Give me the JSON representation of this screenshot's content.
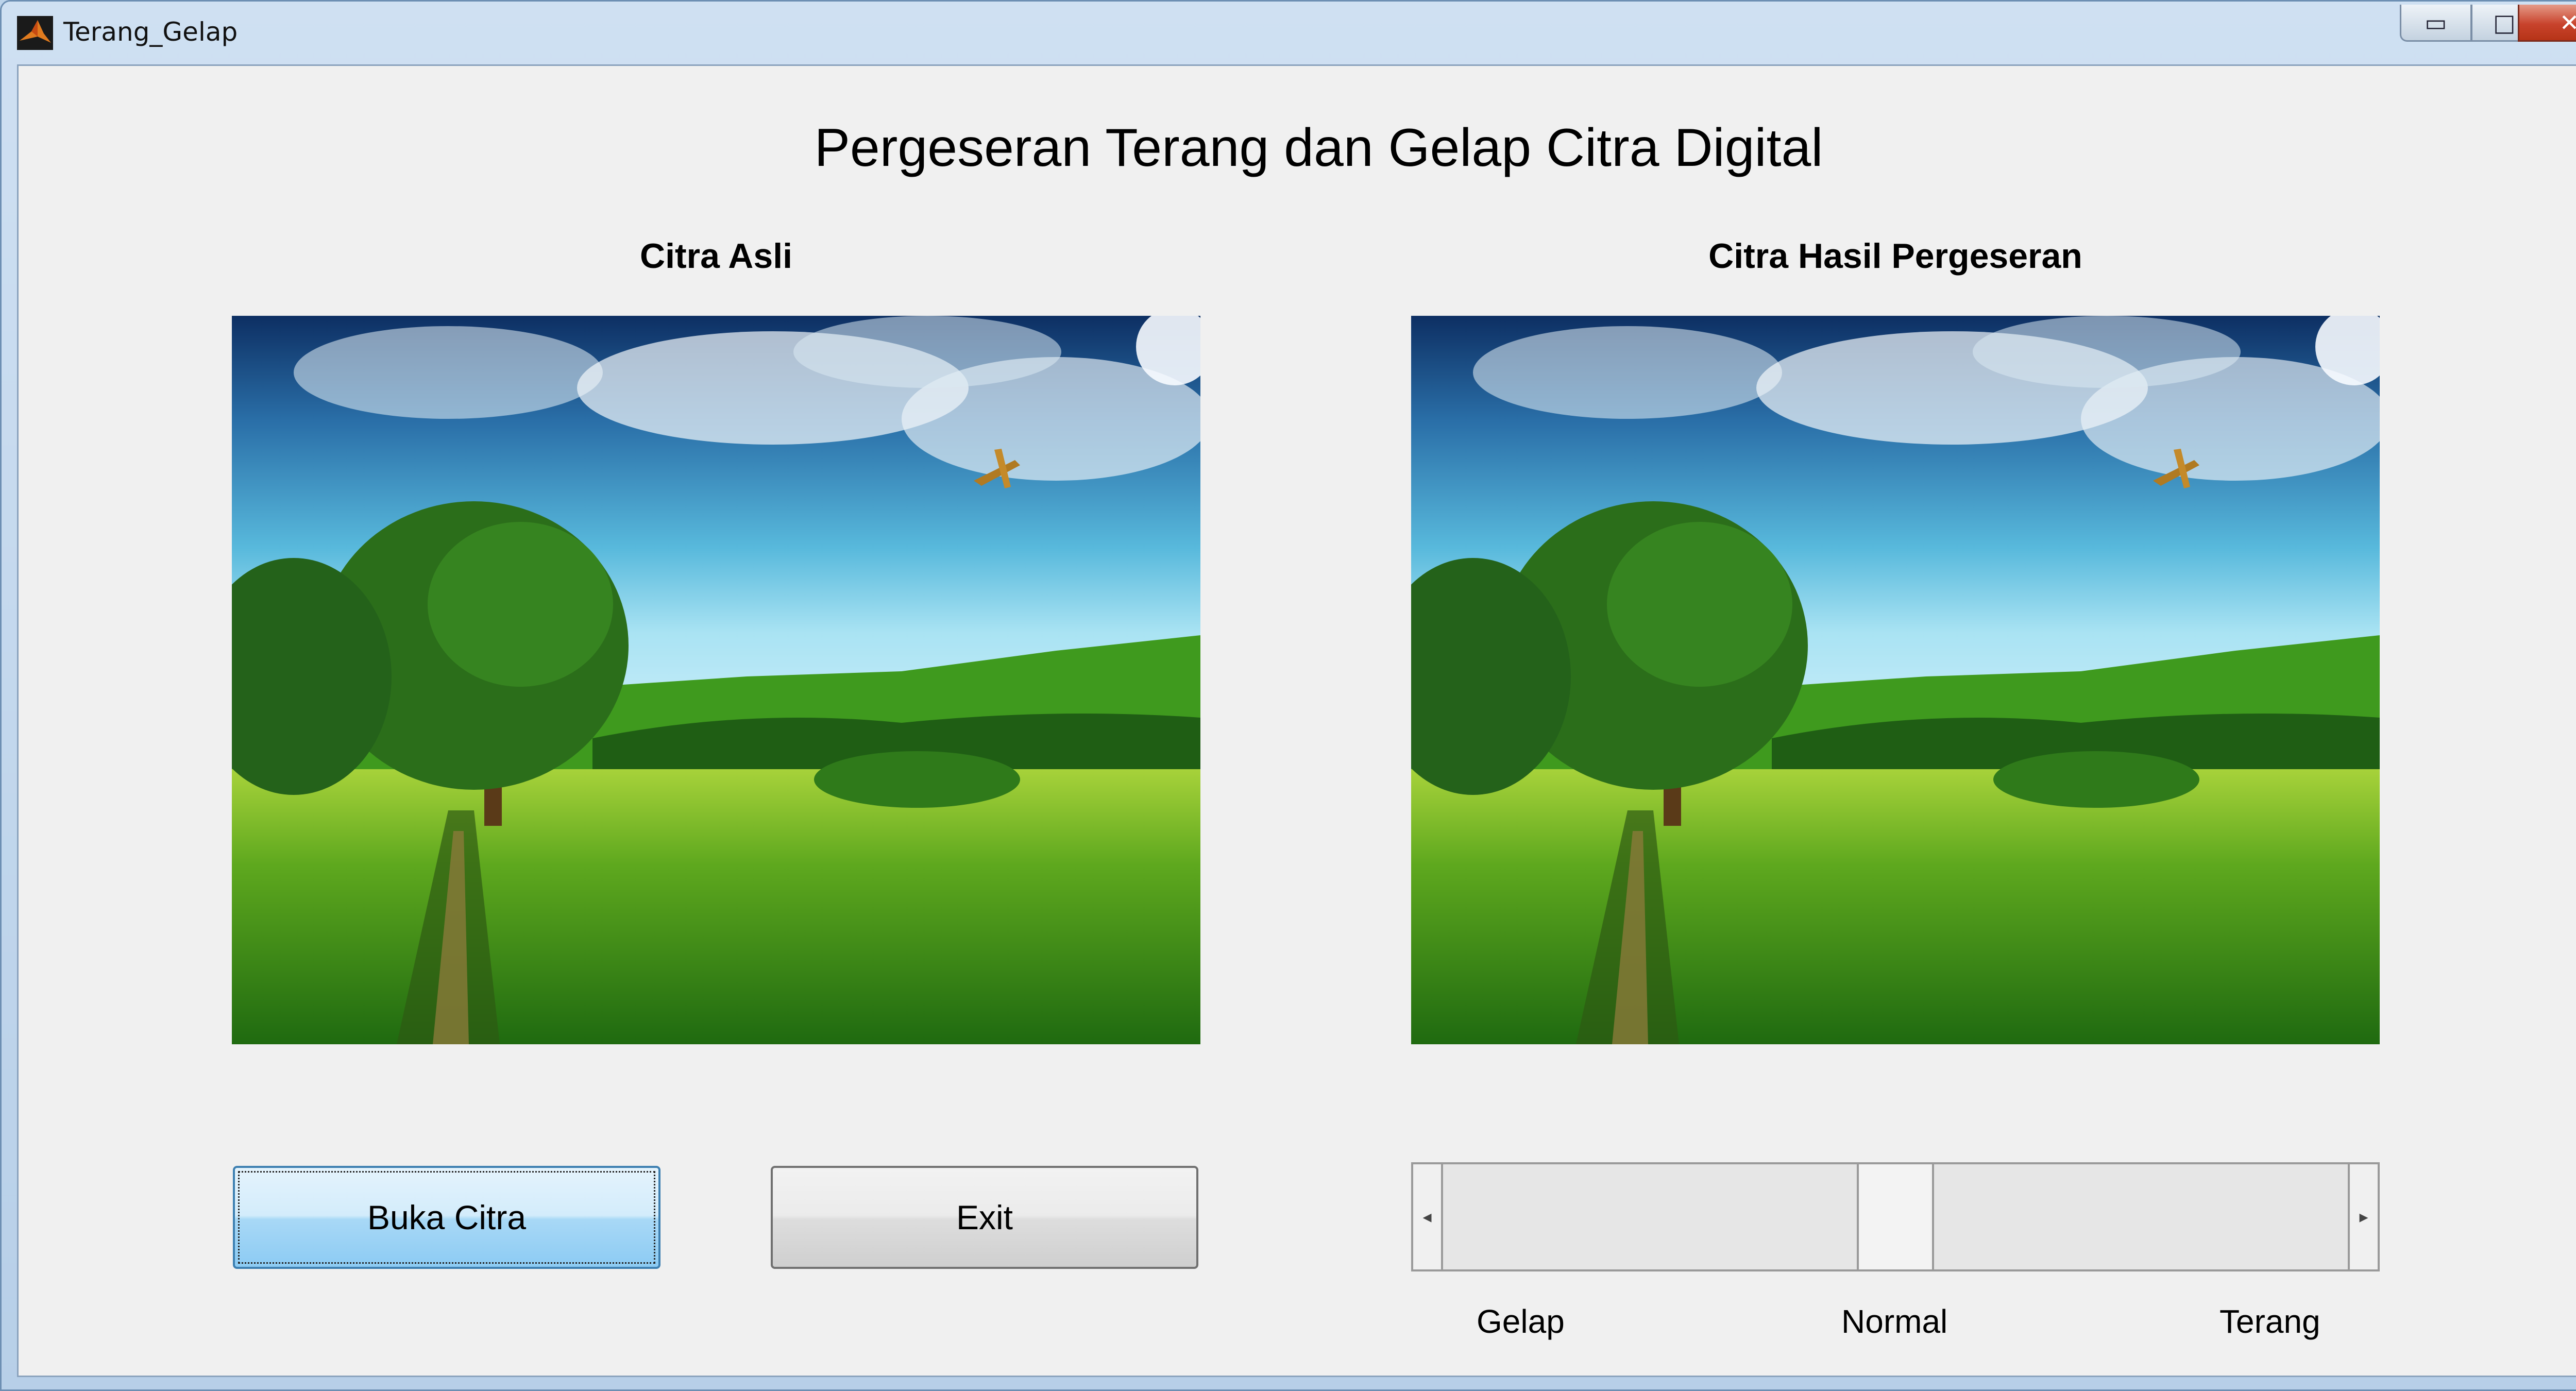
{
  "window": {
    "title": "Terang_Gelap",
    "controls": {
      "minimize": "▭",
      "maximize": "□",
      "close": "✕"
    }
  },
  "heading": "Pergeseran Terang dan Gelap Citra Digital",
  "panels": {
    "original_label": "Citra Asli",
    "result_label": "Citra Hasil Pergeseran"
  },
  "buttons": {
    "open": "Buka Citra",
    "exit": "Exit"
  },
  "slider": {
    "labels": {
      "left": "Gelap",
      "middle": "Normal",
      "right": "Terang"
    },
    "value_fraction": 0.5,
    "arrows": {
      "left": "◂",
      "right": "▸"
    }
  },
  "colors": {
    "sky_top": "#0d2f63",
    "sky_bottom": "#cdeefa",
    "grass": "#3a9a14",
    "accent": "#3c7fb1"
  }
}
